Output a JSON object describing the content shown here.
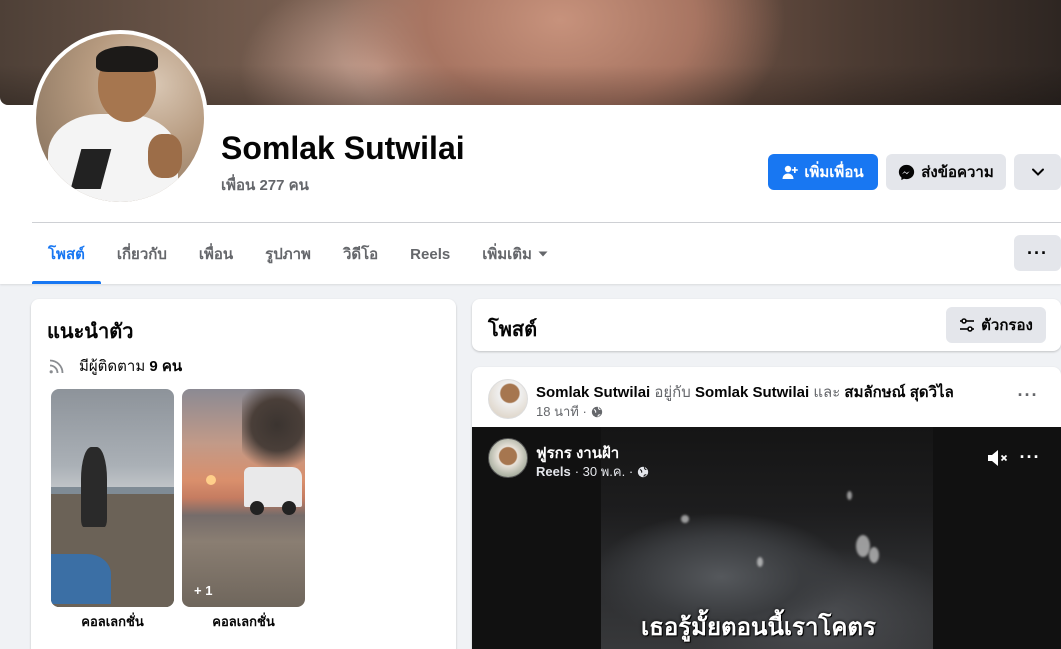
{
  "profile": {
    "name": "Somlak Sutwilai",
    "friends_count": "เพื่อน 277 คน"
  },
  "actions": {
    "add_friend_label": "เพิ่มเพื่อน",
    "message_label": "ส่งข้อความ"
  },
  "tabs": [
    {
      "label": "โพสต์",
      "active": true
    },
    {
      "label": "เกี่ยวกับ",
      "active": false
    },
    {
      "label": "เพื่อน",
      "active": false
    },
    {
      "label": "รูปภาพ",
      "active": false
    },
    {
      "label": "วิดีโอ",
      "active": false
    },
    {
      "label": "Reels",
      "active": false
    },
    {
      "label": "เพิ่มเติม",
      "active": false
    }
  ],
  "intro": {
    "title": "แนะนำตัว",
    "followers_prefix": "มีผู้ติดตาม",
    "followers_value": "9 คน",
    "collections": [
      {
        "label": "คอลเลกชั่น",
        "extra": ""
      },
      {
        "label": "คอลเลกชั่น",
        "extra": "+ 1"
      }
    ]
  },
  "posts": {
    "title": "โพสต์",
    "filter_label": "ตัวกรอง"
  },
  "post": {
    "author": "Somlak Sutwilai",
    "with_text": "อยู่กับ",
    "tagged_1": "Somlak Sutwilai",
    "and_text": "และ",
    "tagged_2": "สมลักษณ์ สุดวิไล",
    "time": "18 นาที ·"
  },
  "reel": {
    "author": "ฟูรกร งานฝ้า",
    "source": "Reels",
    "date": "· 30 พ.ค. ·",
    "caption": "เธอรู้มั้ยตอนนี้เราโคตร"
  },
  "colors": {
    "accent": "#1877f2",
    "secondary_button": "#e4e6eb",
    "page_bg": "#f0f2f5",
    "muted_text": "#65676b"
  }
}
